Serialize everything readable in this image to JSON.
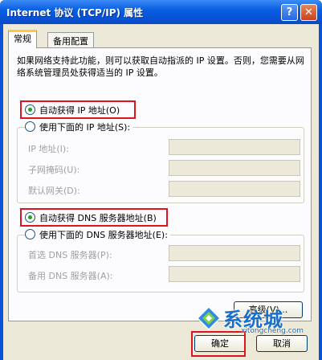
{
  "window": {
    "title": "Internet 协议 (TCP/IP) 属性",
    "help_label": "?",
    "close_label": "✕"
  },
  "tabs": [
    {
      "label": "常规"
    },
    {
      "label": "备用配置"
    }
  ],
  "description": "如果网络支持此功能，则可以获取自动指派的 IP 设置。否则，您需要从网络系统管理员处获得适当的 IP 设置。",
  "ip_section": {
    "auto_option": "自动获得 IP 地址(O)",
    "auto_selected": true,
    "manual_option": "使用下面的 IP 地址(S):",
    "manual_selected": false,
    "fields": [
      {
        "label": "IP 地址(I):",
        "value": ""
      },
      {
        "label": "子网掩码(U):",
        "value": ""
      },
      {
        "label": "默认网关(D):",
        "value": ""
      }
    ]
  },
  "dns_section": {
    "auto_option": "自动获得 DNS 服务器地址(B)",
    "auto_selected": true,
    "manual_option": "使用下面的 DNS 服务器地址(E):",
    "manual_selected": false,
    "fields": [
      {
        "label": "首选 DNS 服务器(P):",
        "value": ""
      },
      {
        "label": "备用 DNS 服务器(A):",
        "value": ""
      }
    ]
  },
  "buttons": {
    "advanced": "高级(V)...",
    "ok": "确定",
    "cancel": "取消"
  },
  "watermark": {
    "brand": "系统城",
    "url": "xitongcheng.com"
  },
  "colors": {
    "title_bar": "#0a5fe3",
    "highlight": "#e0141e",
    "radio_dot": "#21a121",
    "watermark": "#1a6fc9"
  }
}
